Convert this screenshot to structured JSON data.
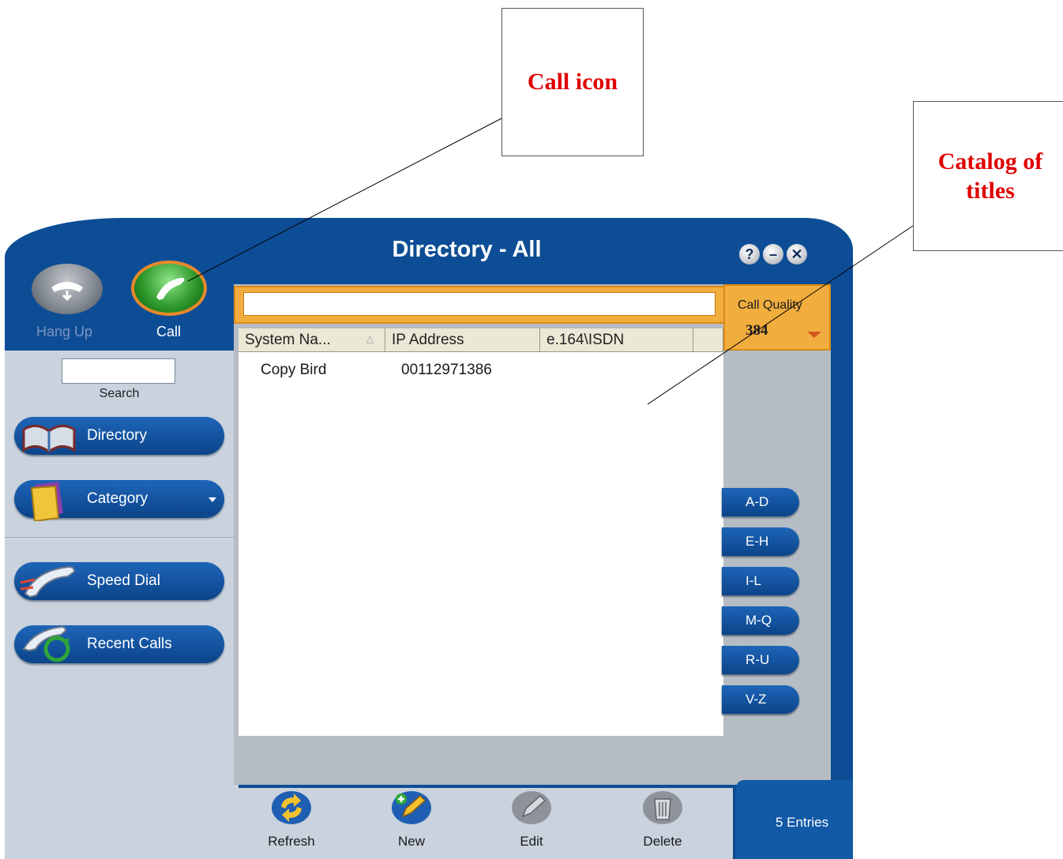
{
  "annotations": {
    "call_icon": "Call icon",
    "catalog": "Catalog of titles"
  },
  "window": {
    "title": "Directory - All",
    "help": "?",
    "minimize": "–",
    "close": "✕"
  },
  "call_controls": {
    "hang_up": "Hang Up",
    "call": "Call"
  },
  "sidebar": {
    "search_label": "Search",
    "items": [
      {
        "label": "Directory",
        "icon": "open-book-icon"
      },
      {
        "label": "Category",
        "icon": "folder-icon"
      },
      {
        "label": "Speed Dial",
        "icon": "phone-receiver-icon"
      },
      {
        "label": "Recent Calls",
        "icon": "recent-calls-icon"
      }
    ]
  },
  "call_quality": {
    "label": "Call Quality",
    "value": "384"
  },
  "table": {
    "columns": [
      "System Na...",
      "IP Address",
      "e.164\\ISDN"
    ],
    "rows": [
      {
        "system_name": "Copy Bird",
        "ip_address": "00112971386",
        "e164": ""
      }
    ]
  },
  "alphabet_index": [
    "A-D",
    "E-H",
    "I-L",
    "M-Q",
    "R-U",
    "V-Z"
  ],
  "toolbar": {
    "refresh": "Refresh",
    "new": "New",
    "edit": "Edit",
    "delete": "Delete"
  },
  "status": {
    "entries": "5 Entries"
  },
  "colors": {
    "frame": "#0d4d95",
    "accent_orange": "#f1ad3e",
    "annotation_red": "#e00000"
  }
}
